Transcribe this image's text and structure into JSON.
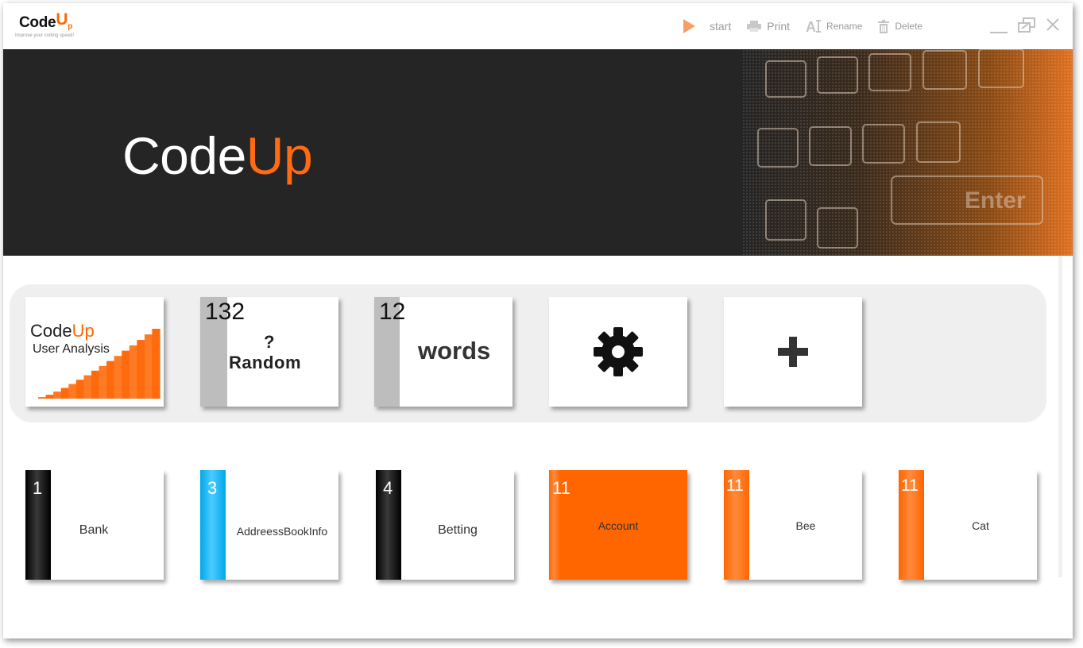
{
  "app": {
    "logo_word": "Code",
    "logo_u": "U",
    "logo_p": "p",
    "logo_tagline": "Improve your coding speed!"
  },
  "toolbar": {
    "start_label": "start",
    "print_label": "Print",
    "rename_label": "Rename",
    "delete_label": "Delete"
  },
  "banner": {
    "title_part1": "Code",
    "title_part2": "Up",
    "art_key_text": "Enter"
  },
  "features": {
    "analysis": {
      "title_part1": "Code",
      "title_part2": "Up",
      "subtitle": "User Analysis"
    },
    "random": {
      "count": "132",
      "question": "?",
      "label": "Random"
    },
    "words": {
      "count": "12",
      "label": "words"
    },
    "settings": {
      "icon": "gear-icon"
    },
    "add": {
      "icon": "plus-icon"
    }
  },
  "categories": [
    {
      "count": "1",
      "name": "Bank",
      "accent": "#000000",
      "style": "bar"
    },
    {
      "count": "3",
      "name": "AddreessBookInfo",
      "accent": "#00b0f0",
      "style": "bar"
    },
    {
      "count": "4",
      "name": "Betting",
      "accent": "#000000",
      "style": "bar"
    },
    {
      "count": "11",
      "name": "Account",
      "accent": "#ff6600",
      "style": "filled"
    },
    {
      "count": "11",
      "name": "Bee",
      "accent": "#ff6600",
      "style": "bar"
    },
    {
      "count": "11",
      "name": "Cat",
      "accent": "#ff6600",
      "style": "bar"
    }
  ],
  "colors": {
    "brand_orange": "#ff6600",
    "banner_bg": "#252525",
    "strip_bg": "#efefef",
    "random_bar": "#bdbdbd"
  }
}
